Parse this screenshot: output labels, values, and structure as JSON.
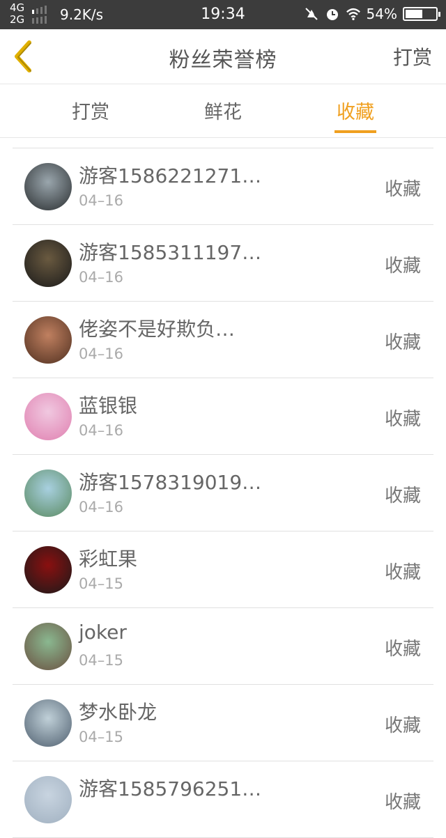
{
  "status_bar": {
    "net_top": "4G",
    "net_bottom": "2G",
    "speed": "9.2K/s",
    "time": "19:34",
    "battery": "54%",
    "icons": [
      "mute-icon",
      "alarm-icon",
      "wifi-icon",
      "battery-icon"
    ]
  },
  "nav": {
    "title": "粉丝荣誉榜",
    "right_action": "打赏",
    "back_icon": "chevron-left-icon"
  },
  "tabs": [
    {
      "label": "打赏",
      "active": false
    },
    {
      "label": "鲜花",
      "active": false
    },
    {
      "label": "收藏",
      "active": true
    }
  ],
  "accent_color": "#f0a020",
  "list": [
    {
      "name": "游客1586221271…",
      "date": "04–16",
      "action": "收藏",
      "avatar_colors": [
        "#9aa6ad",
        "#2a2e30"
      ]
    },
    {
      "name": "游客1585311197…",
      "date": "04–16",
      "action": "收藏",
      "avatar_colors": [
        "#6a5a40",
        "#1a1a1a"
      ]
    },
    {
      "name": "佬姿不是好欺负…",
      "date": "04–16",
      "action": "收藏",
      "avatar_colors": [
        "#c08060",
        "#503020"
      ]
    },
    {
      "name": "蓝银银",
      "date": "04–16",
      "action": "收藏",
      "avatar_colors": [
        "#f0c8e0",
        "#e080b0"
      ]
    },
    {
      "name": "游客1578319019…",
      "date": "04–16",
      "action": "收藏",
      "avatar_colors": [
        "#a8d0e0",
        "#5a8a60"
      ]
    },
    {
      "name": "彩虹果",
      "date": "04–15",
      "action": "收藏",
      "avatar_colors": [
        "#8a1010",
        "#1a1a1a"
      ]
    },
    {
      "name": "joker",
      "date": "04–15",
      "action": "收藏",
      "avatar_colors": [
        "#8ab890",
        "#6a5040"
      ]
    },
    {
      "name": "梦水卧龙",
      "date": "04–15",
      "action": "收藏",
      "avatar_colors": [
        "#c0d0d8",
        "#506070"
      ]
    },
    {
      "name": "游客1585796251…",
      "date": "",
      "action": "收藏",
      "avatar_colors": [
        "#c8d4e0",
        "#a0b0c0"
      ]
    }
  ]
}
